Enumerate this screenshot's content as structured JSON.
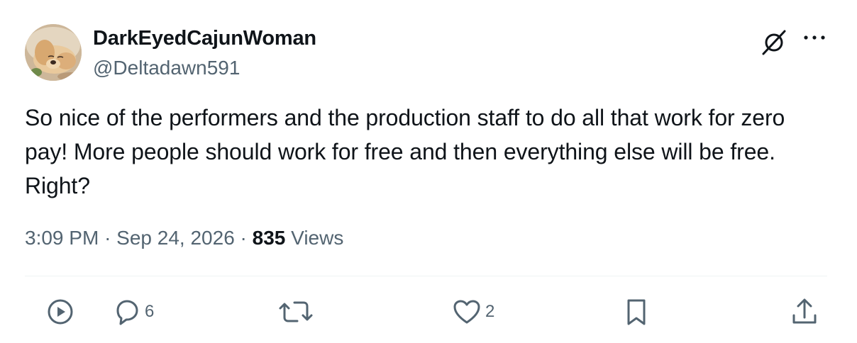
{
  "tweet": {
    "author": {
      "display_name": "DarkEyedCajunWoman",
      "handle": "@Deltadawn591"
    },
    "text": "So nice of the performers and the production staff to do all that work for zero pay! More people should work for free and then everything else will be free. Right?",
    "time": "3:09 PM",
    "separator": "·",
    "date": "Sep 24, 2026",
    "views_count": "835",
    "views_label": "Views"
  },
  "header_icons": [
    "grok-icon",
    "more-icon"
  ],
  "actions": {
    "view_stats": {
      "icon": "play-circle-icon"
    },
    "reply": {
      "icon": "reply-icon",
      "count": "6"
    },
    "repost": {
      "icon": "repost-icon"
    },
    "like": {
      "icon": "heart-icon",
      "count": "2"
    },
    "bookmark": {
      "icon": "bookmark-icon"
    },
    "share": {
      "icon": "share-icon"
    }
  },
  "colors": {
    "primary_text": "#0f1419",
    "secondary_text": "#536471",
    "divider": "#eff3f4"
  }
}
